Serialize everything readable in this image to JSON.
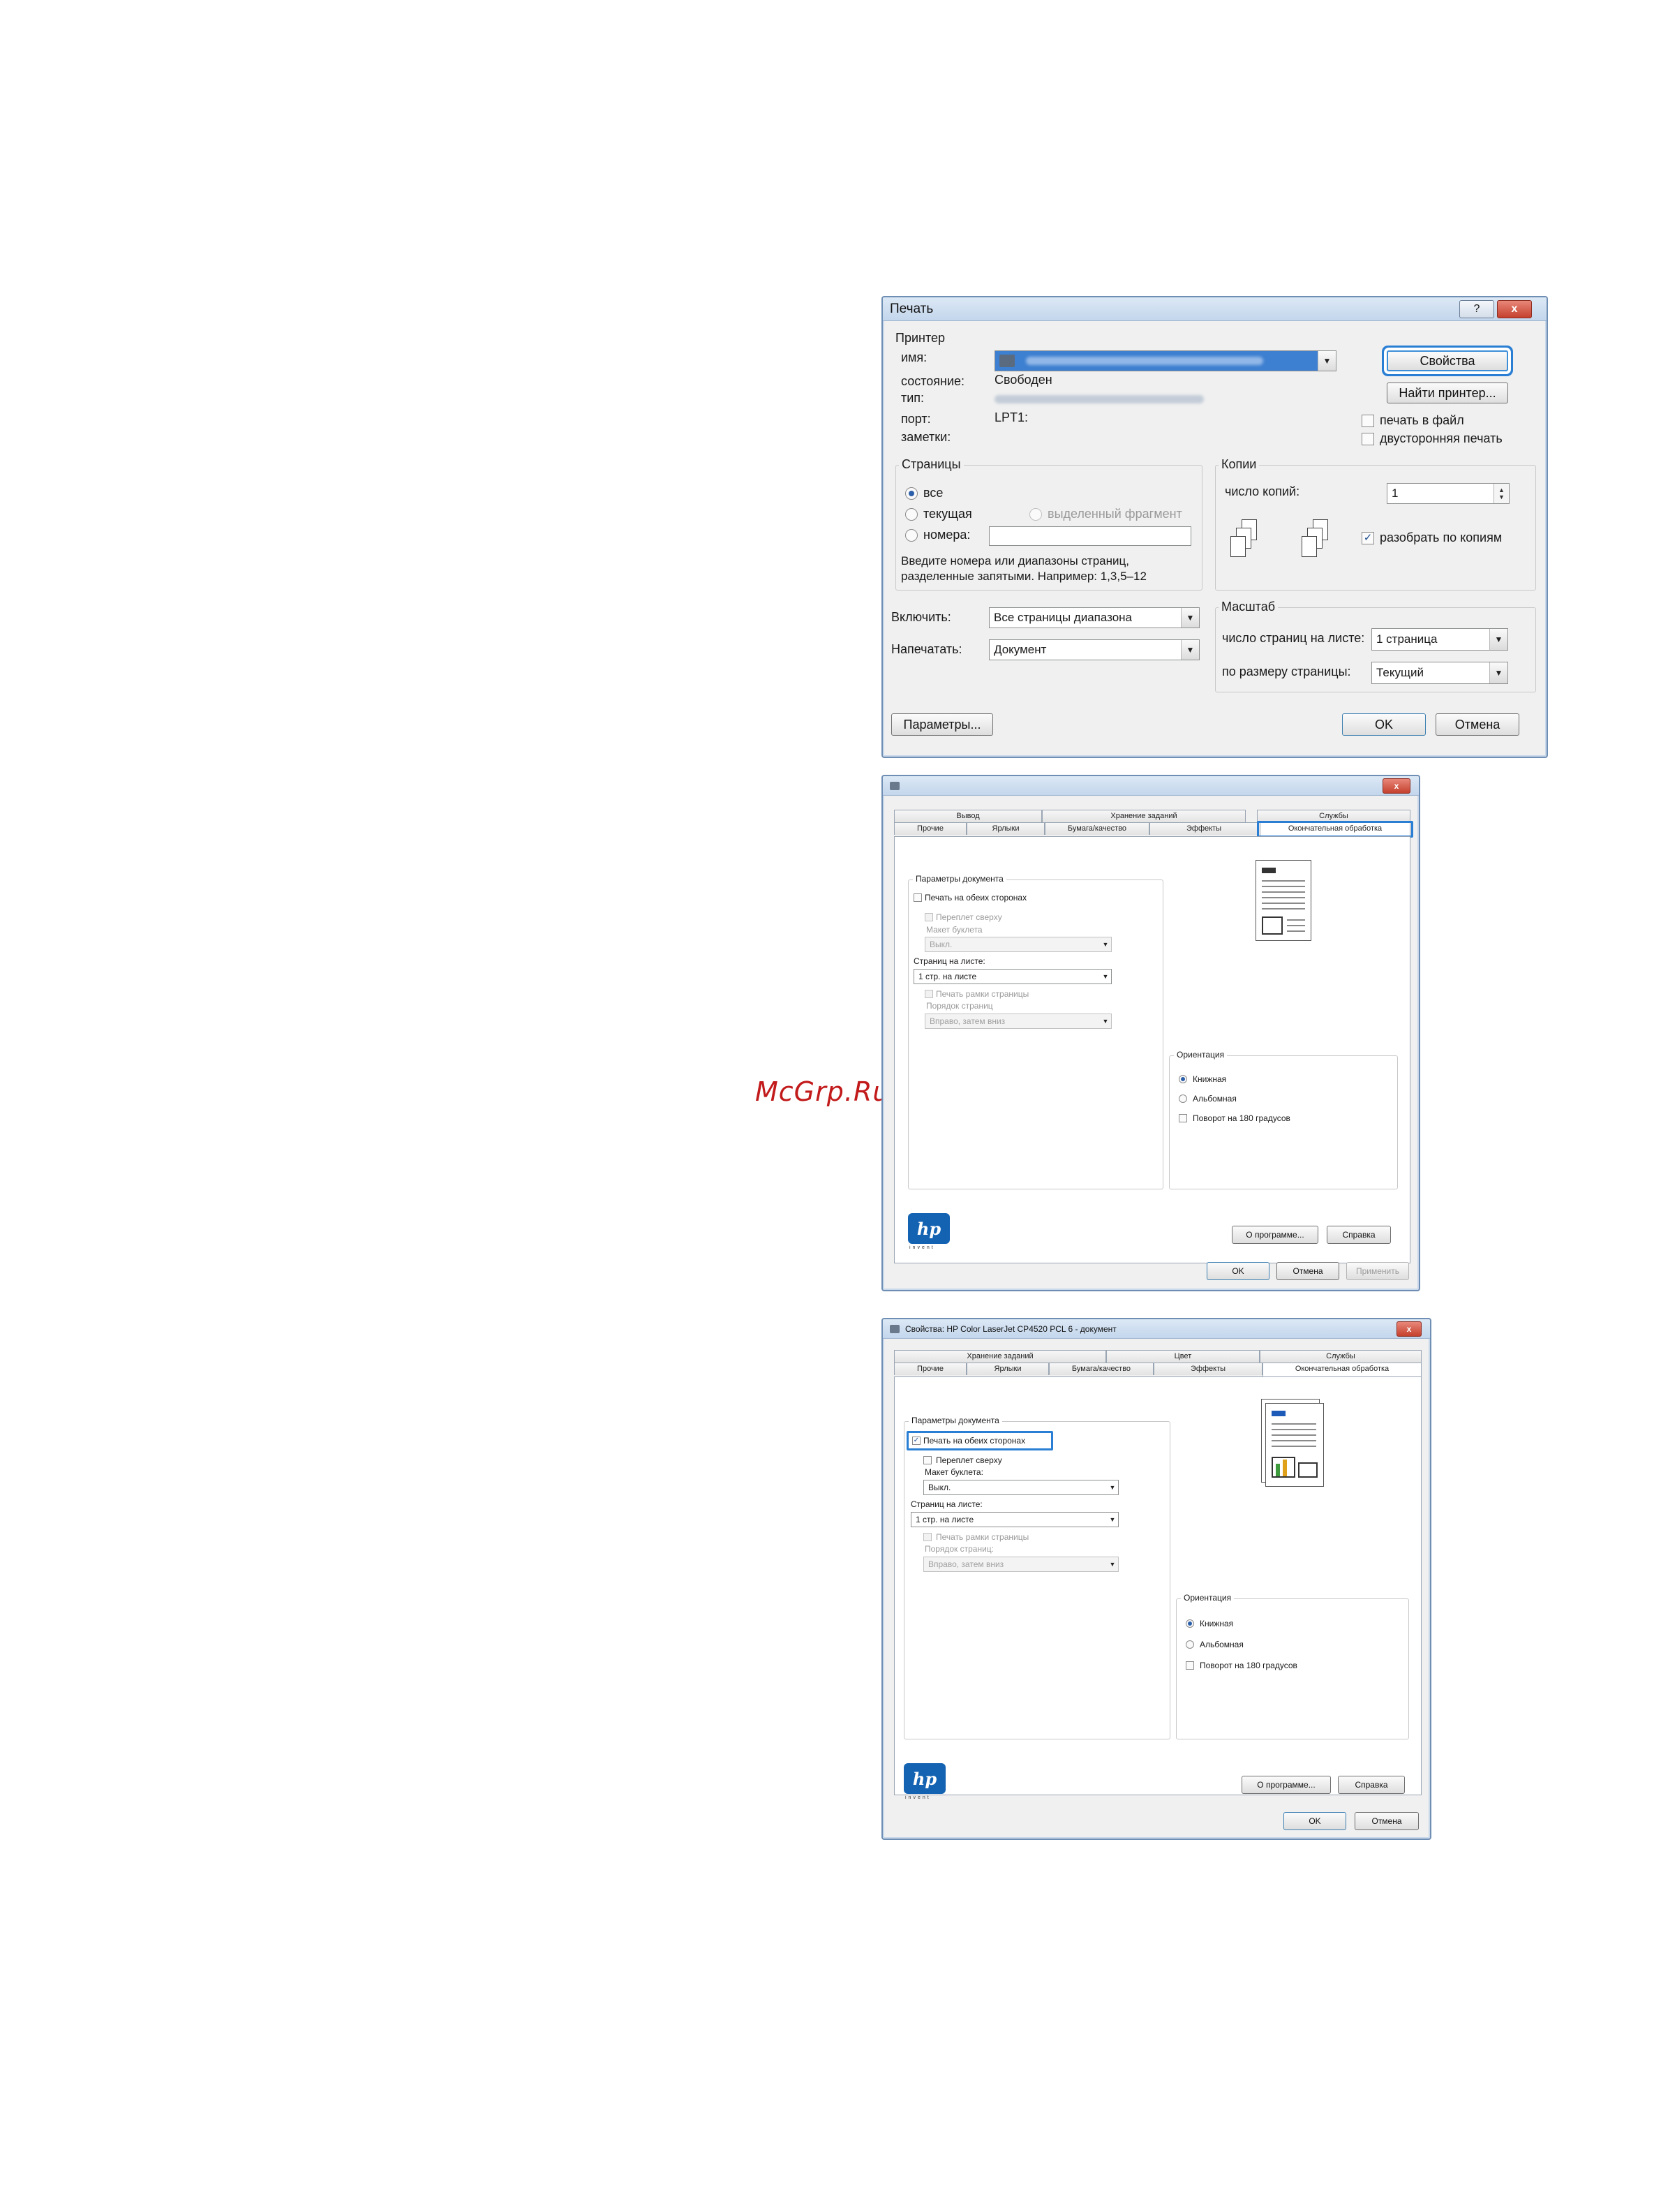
{
  "watermark": "McGrp.Ru",
  "print_dialog": {
    "title": "Печать",
    "help_btn": "?",
    "close_btn": "x",
    "printer_group": "Принтер",
    "name_label": "имя:",
    "status_label": "состояние:",
    "status_value": "Свободен",
    "type_label": "тип:",
    "port_label": "порт:",
    "port_value": "LPT1:",
    "notes_label": "заметки:",
    "properties_btn": "Свойства",
    "find_printer_btn": "Найти принтер...",
    "print_to_file": "печать в файл",
    "duplex": "двусторонняя печать",
    "pages_group": "Страницы",
    "all": "все",
    "current": "текущая",
    "selection": "выделенный фрагмент",
    "pages": "номера:",
    "pages_hint_1": "Введите номера или диапазоны страниц,",
    "pages_hint_2": "разделенные запятыми. Например: 1,3,5–12",
    "copies_group": "Копии",
    "copies_label": "число копий:",
    "copies_value": "1",
    "collate": "разобрать по копиям",
    "include_label": "Включить:",
    "include_value": "Все страницы диапазона",
    "print_what_label": "Напечатать:",
    "print_what_value": "Документ",
    "zoom_group": "Масштаб",
    "pages_per_sheet_label": "число страниц на листе:",
    "pages_per_sheet_value": "1 страница",
    "scale_label": "по размеру страницы:",
    "scale_value": "Текущий",
    "options_btn": "Параметры...",
    "ok_btn": "OK",
    "cancel_btn": "Отмена"
  },
  "props_dialog_1": {
    "tabs_row1": [
      "Вывод",
      "Хранение заданий",
      "Службы"
    ],
    "tabs_row2": [
      "Прочие",
      "Ярлыки",
      "Бумага/качество",
      "Эффекты",
      "Окончательная обработка"
    ],
    "doc_options_group": "Параметры документа",
    "print_both_sides": "Печать на обеих сторонах",
    "flip_up": "Переплет сверху",
    "booklet_layout": "Макет буклета",
    "booklet_value": "Выкл.",
    "pages_per_sheet": "Страниц на листе:",
    "pages_per_sheet_value": "1 стр. на листе",
    "print_page_borders": "Печать рамки страницы",
    "page_order": "Порядок страниц",
    "page_order_value": "Вправо, затем вниз",
    "orientation_group": "Ориентация",
    "portrait": "Книжная",
    "landscape": "Альбомная",
    "rotate_180": "Поворот на 180 градусов",
    "about_btn": "О программе...",
    "help_btn": "Справка",
    "ok_btn": "OK",
    "cancel_btn": "Отмена",
    "apply_btn": "Применить",
    "hp_logo": "hp",
    "hp_invent": "invent"
  },
  "props_dialog_2": {
    "title": "Свойства: HP Color LaserJet CP4520 PCL 6 - документ",
    "tabs_row1": [
      "Хранение заданий",
      "Цвет",
      "Службы"
    ],
    "tabs_row2": [
      "Прочие",
      "Ярлыки",
      "Бумага/качество",
      "Эффекты",
      "Окончательная обработка"
    ],
    "doc_options_group": "Параметры документа",
    "print_both_sides": "Печать на обеих сторонах",
    "flip_up": "Переплет сверху",
    "booklet_layout": "Макет буклета:",
    "booklet_value": "Выкл.",
    "pages_per_sheet": "Страниц на листе:",
    "pages_per_sheet_value": "1 стр. на листе",
    "print_page_borders": "Печать рамки страницы",
    "page_order": "Порядок страниц:",
    "page_order_value": "Вправо, затем вниз",
    "orientation_group": "Ориентация",
    "portrait": "Книжная",
    "landscape": "Альбомная",
    "rotate_180": "Поворот на 180 градусов",
    "about_btn": "О программе...",
    "help_btn": "Справка",
    "ok_btn": "OK",
    "cancel_btn": "Отмена",
    "hp_logo": "hp",
    "hp_invent": "invent"
  },
  "colors": {
    "accent": "#2a7fd4",
    "title_bar": "#c3d6ec",
    "close_red": "#c5402d",
    "watermark": "#c21a1a"
  }
}
